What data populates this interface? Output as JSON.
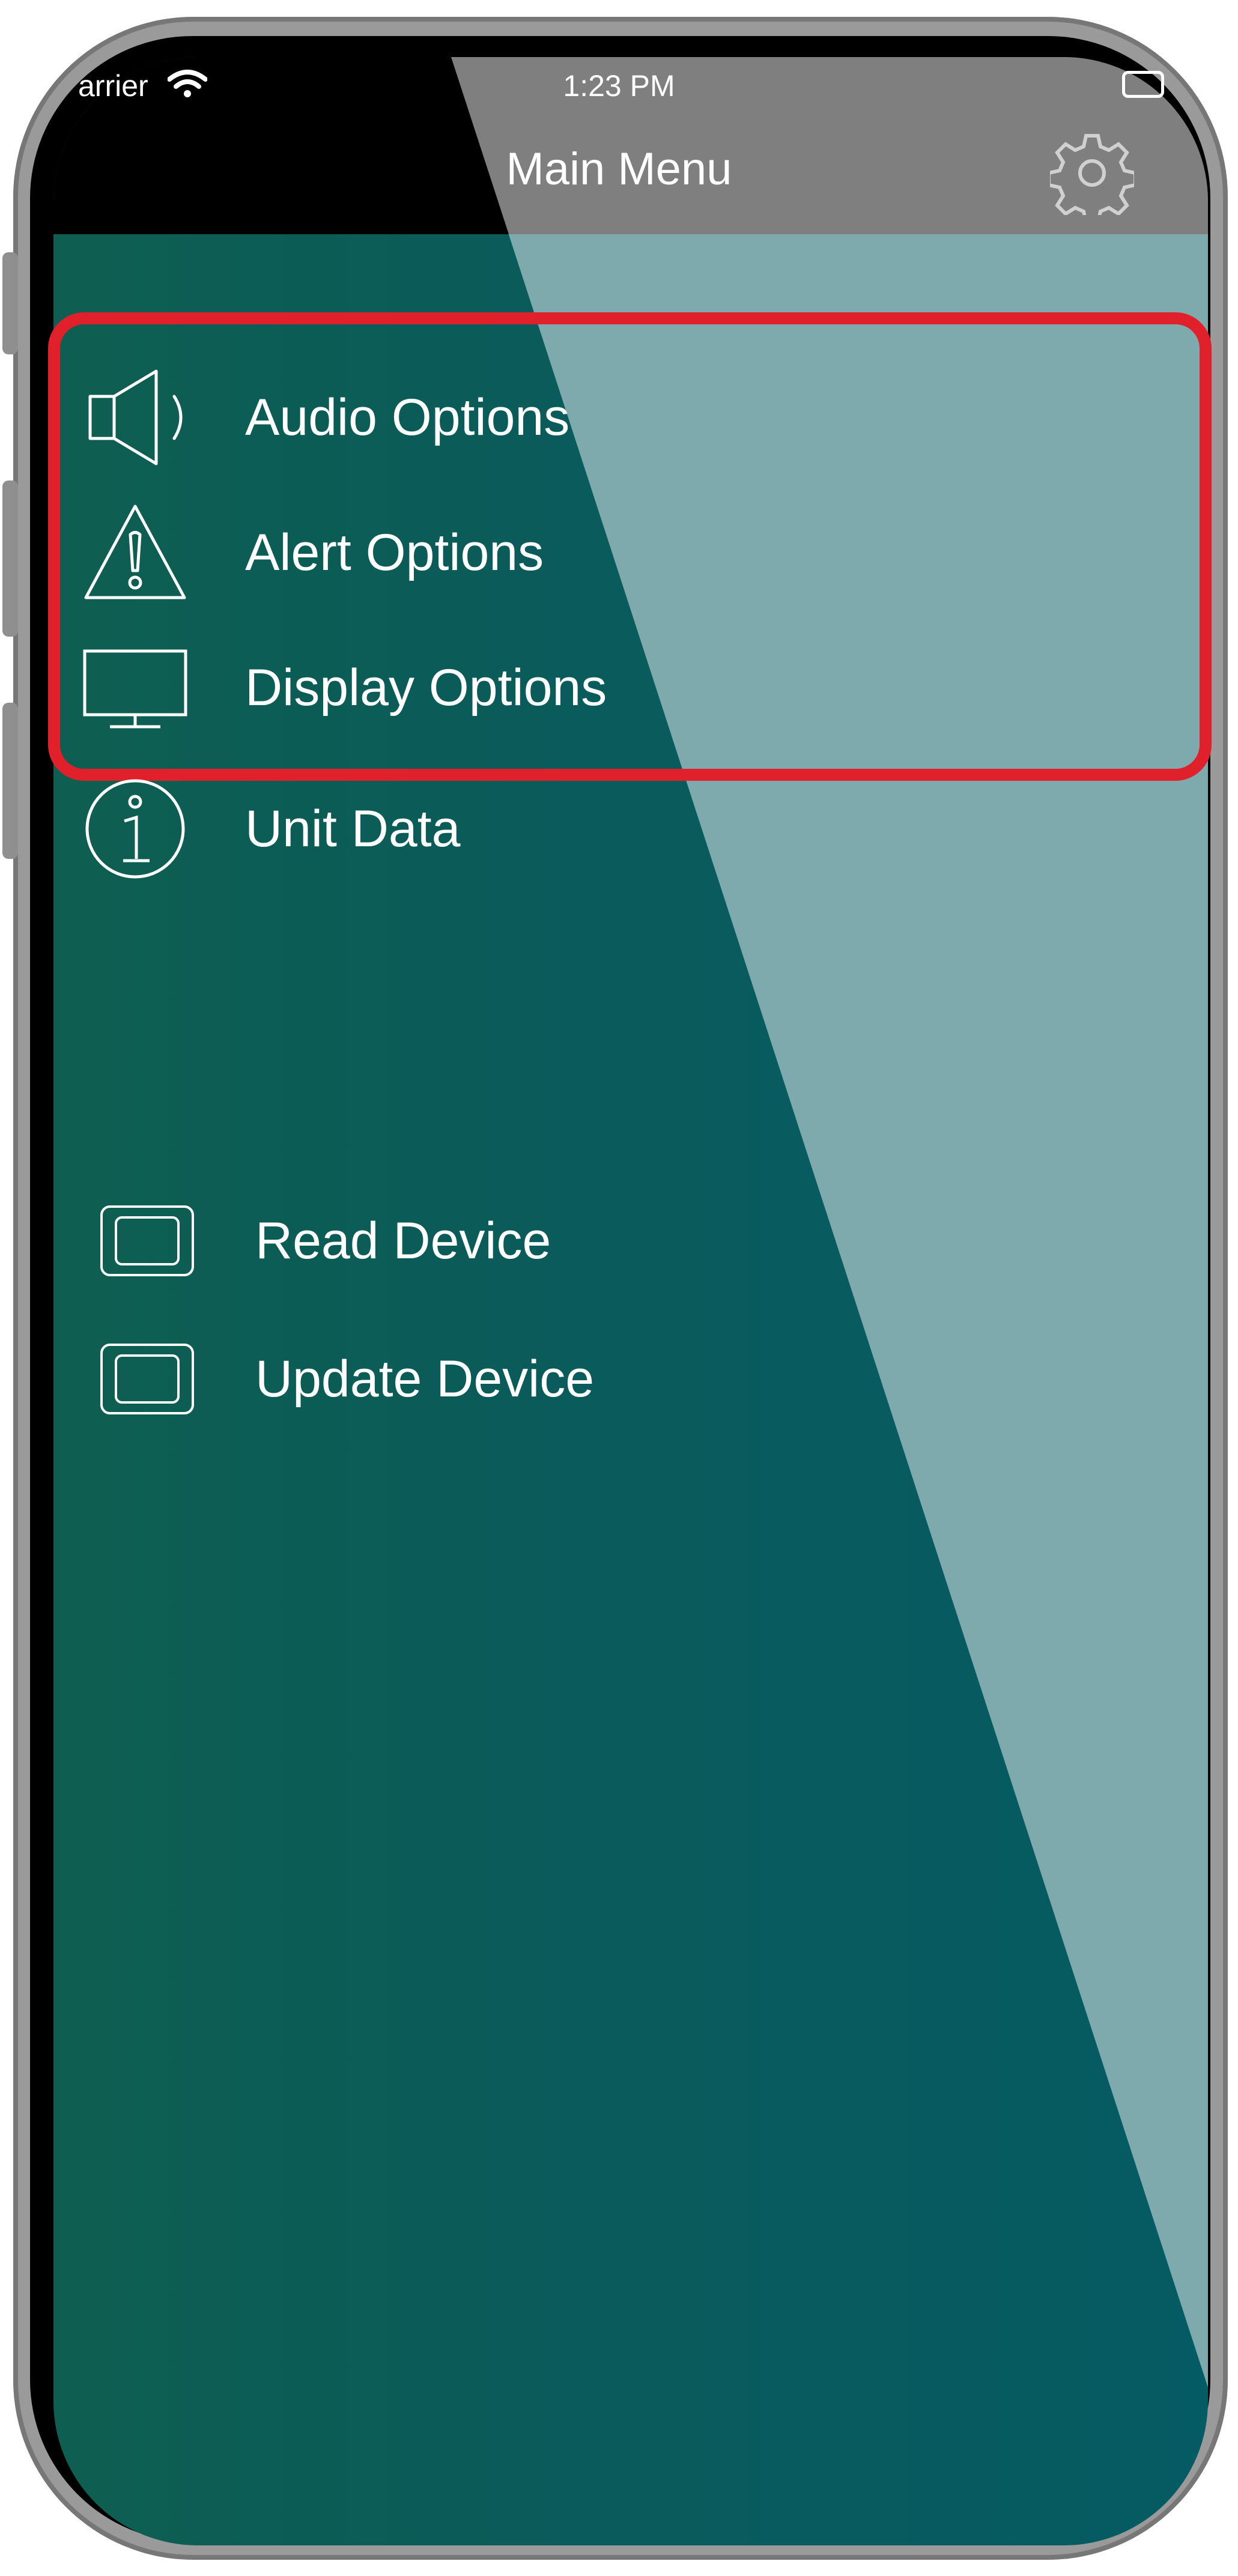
{
  "status_bar": {
    "carrier": "arrier",
    "time": "1:23 PM"
  },
  "navbar": {
    "title": "Main Menu",
    "settings_icon": "gear-icon"
  },
  "menu": {
    "items": [
      {
        "label": "Audio Options",
        "icon": "speaker-icon"
      },
      {
        "label": "Alert Options",
        "icon": "warning-icon"
      },
      {
        "label": "Display Options",
        "icon": "monitor-icon"
      },
      {
        "label": "Unit Data",
        "icon": "info-icon"
      }
    ],
    "device_items": [
      {
        "label": "Read Device",
        "icon": "device-icon"
      },
      {
        "label": "Update Device",
        "icon": "device-icon"
      }
    ]
  },
  "colors": {
    "background_teal": "#0a5b5b",
    "diagonal_light": "#7eaaae",
    "navbar_gray": "#7f7f7f",
    "highlight_red": "#e0202b",
    "text": "#ffffff"
  }
}
